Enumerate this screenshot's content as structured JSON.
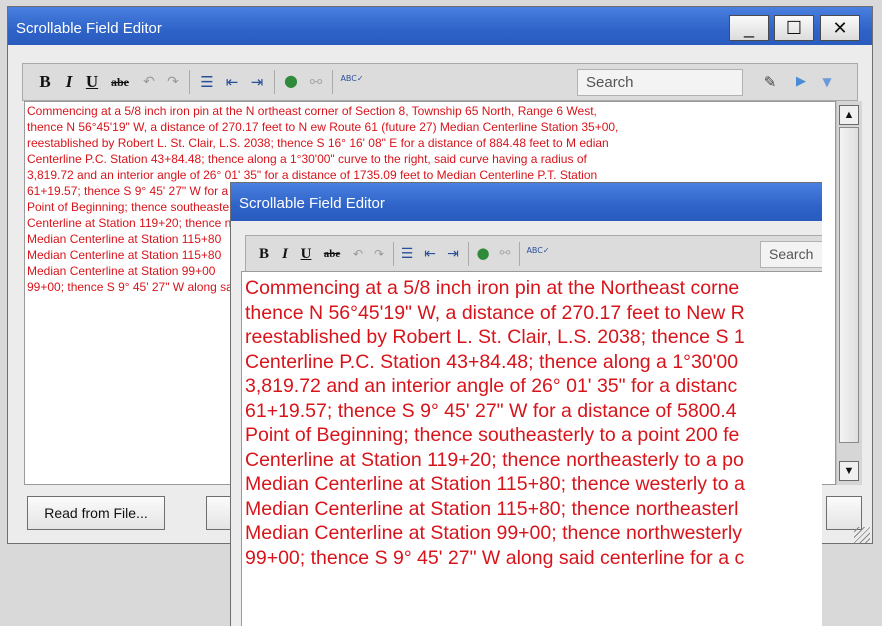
{
  "back_window": {
    "title": "Scrollable Field Editor",
    "controls": {
      "minimize": "_",
      "maximize": "☐",
      "close": "✕"
    },
    "toolbar": {
      "bold": "B",
      "italic": "I",
      "underline": "U",
      "strike": "abe",
      "undo": "↶",
      "redo": "↷",
      "bullets": "☰",
      "outdent": "⇤",
      "indent": "⇥",
      "link": "●",
      "unlink": "⚯",
      "spell": "ABC✓",
      "search_placeholder": "Search",
      "clear_search": "✎",
      "next": "▶",
      "dropdown": "▼"
    },
    "text_lines": [
      "Commencing at a 5/8 inch iron pin at the N ortheast corner of Section 8, Township 65 North, Range 6 West,",
      "thence N 56°45'19\" W, a distance of 270.17 feet to N ew Route 61 (future 27) Median Centerline Station 35+00,",
      "reestablished by Robert L. St. Clair, L.S. 2038; thence S 16° 16' 08\" E for a distance of 884.48 feet to M edian",
      "Centerline P.C. Station 43+84.48; thence along a 1°30'00\" curve to the right, said curve having a radius of",
      "3,819.72 and an interior angle of 26° 01' 35\" for a distance of 1735.09 feet to Median Centerline P.T. Station",
      "61+19.57; thence S 9° 45' 27\" W for a distance of 5800.43 feet to a point",
      "Point of Beginning; thence southeasterly to a point 200 feet",
      "Centerline at Station 119+20; thence northeasterly",
      "Median Centerline at Station 115+80",
      "Median Centerline at Station 115+80",
      "Median Centerline at Station 99+00",
      "99+00; thence S 9° 45' 27\" W along said centerline"
    ],
    "scroll": {
      "up": "▲",
      "down": "▼"
    },
    "read_button": "Read from File..."
  },
  "front_window": {
    "title": "Scrollable Field Editor",
    "toolbar": {
      "bold": "B",
      "italic": "I",
      "underline": "U",
      "strike": "abe",
      "undo": "↶",
      "redo": "↷",
      "bullets": "☰",
      "outdent": "⇤",
      "indent": "⇥",
      "link": "●",
      "unlink": "⚯",
      "spell": "ABC✓",
      "search_placeholder": "Search"
    },
    "text_lines": [
      "Commencing at a 5/8 inch iron pin at the Northeast corne",
      "thence N 56°45'19\" W, a distance of 270.17 feet to New R",
      "reestablished by Robert L. St. Clair, L.S. 2038; thence S 1",
      "Centerline P.C. Station 43+84.48; thence along a 1°30'00",
      "3,819.72 and an interior angle of 26° 01' 35\" for a distanc",
      "61+19.57; thence S 9° 45' 27\" W for a distance of 5800.4",
      "Point of Beginning; thence southeasterly to a point 200 fe",
      "Centerline at Station 119+20; thence northeasterly to a po",
      "Median Centerline at Station 115+80; thence westerly to a",
      "Median Centerline at Station 115+80; thence northeasterl",
      "Median Centerline at Station 99+00; thence northwesterly",
      "99+00; thence S 9° 45' 27\" W along said centerline for a c"
    ]
  },
  "colors": {
    "title_bar": "#2f63c8",
    "text_red": "#d8141b",
    "background": "#d9d9d9"
  }
}
